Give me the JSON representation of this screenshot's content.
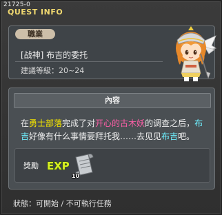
{
  "window": {
    "quest_id": "21725-0",
    "title": "QUEST INFO"
  },
  "quest": {
    "job_badge": "職業",
    "name": "[战神] 布吉的委托",
    "level_label": "建議等級",
    "level_value": "20~24"
  },
  "content": {
    "header": "內容",
    "desc_1": "在",
    "desc_2": "勇士部落",
    "desc_3": "完成了对",
    "desc_4": "开心的古木妖",
    "desc_5": "的调查之后，",
    "desc_6": "布吉",
    "desc_7": "好像有什么事情要拜托我……去见见",
    "desc_8": "布吉",
    "desc_9": "吧。"
  },
  "reward": {
    "label": "獎勵",
    "exp_text": "EXP",
    "item_count": "10"
  },
  "status": {
    "label": "狀態",
    "value": "可開始 / 不可執行任務"
  },
  "colors": {
    "title": "#f0d870",
    "highlight_yellow": "#f4e400",
    "highlight_pink": "#ff5fa8",
    "highlight_cyan": "#6ef0ff"
  }
}
